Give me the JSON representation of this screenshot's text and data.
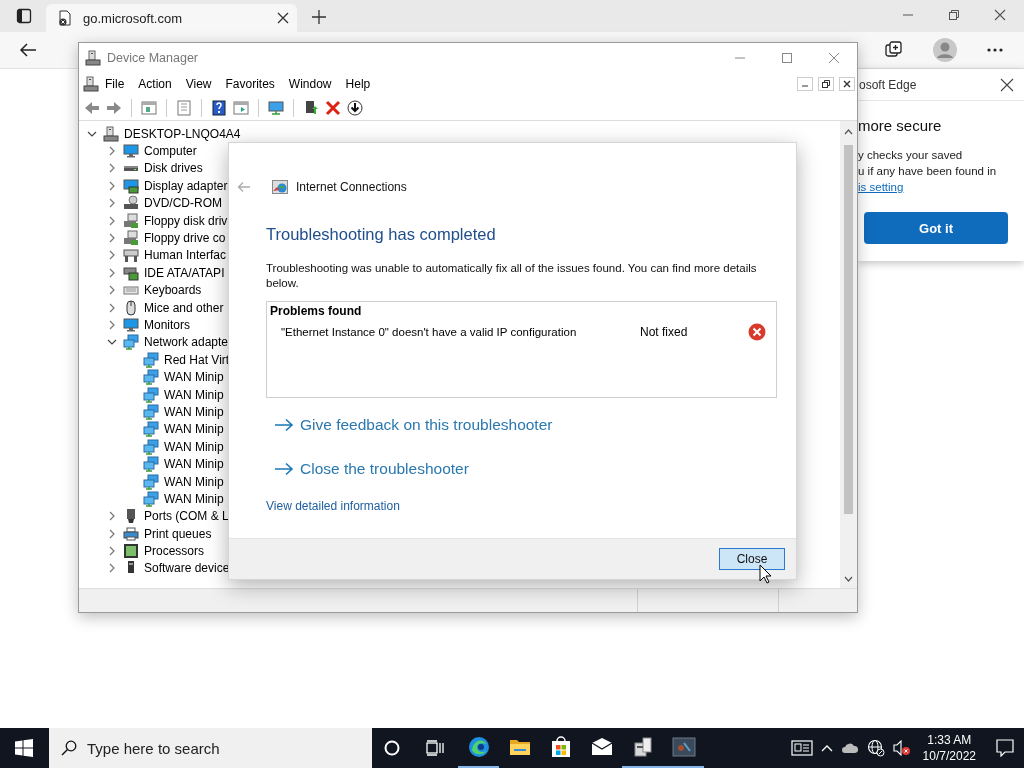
{
  "browser": {
    "tab": {
      "title": "go.microsoft.com",
      "selected": true
    },
    "popup": {
      "title": "osoft Edge",
      "heading": "more secure",
      "lines": [
        "y checks your saved",
        "u if any have been found in"
      ],
      "link": "is setting",
      "button": "Got it"
    }
  },
  "device_manager": {
    "title": "Device Manager",
    "menu": [
      "File",
      "Action",
      "View",
      "Favorites",
      "Window",
      "Help"
    ],
    "tree": {
      "label": "DESKTOP-LNQO4A4",
      "kind": "pc",
      "expanded": true,
      "children": [
        {
          "label": "Computer",
          "kind": "monitor",
          "expanded": false
        },
        {
          "label": "Disk drives",
          "kind": "drive",
          "expanded": false
        },
        {
          "label": "Display adapter",
          "kind": "display",
          "expanded": false
        },
        {
          "label": "DVD/CD-ROM",
          "kind": "disc",
          "expanded": false
        },
        {
          "label": "Floppy disk driv",
          "kind": "floppy",
          "expanded": false
        },
        {
          "label": "Floppy drive co",
          "kind": "floppy",
          "expanded": false
        },
        {
          "label": "Human Interfac",
          "kind": "hid",
          "expanded": false
        },
        {
          "label": "IDE ATA/ATAPI",
          "kind": "chip",
          "expanded": false
        },
        {
          "label": "Keyboards",
          "kind": "keyboard",
          "expanded": false
        },
        {
          "label": "Mice and other",
          "kind": "mouse",
          "expanded": false
        },
        {
          "label": "Monitors",
          "kind": "monitor",
          "expanded": false
        },
        {
          "label": "Network adapte",
          "kind": "network",
          "expanded": true,
          "children": [
            {
              "label": "Red Hat Virt",
              "kind": "network"
            },
            {
              "label": "WAN Minip",
              "kind": "network"
            },
            {
              "label": "WAN Minip",
              "kind": "network"
            },
            {
              "label": "WAN Minip",
              "kind": "network"
            },
            {
              "label": "WAN Minip",
              "kind": "network"
            },
            {
              "label": "WAN Minip",
              "kind": "network"
            },
            {
              "label": "WAN Minip",
              "kind": "network"
            },
            {
              "label": "WAN Minip",
              "kind": "network"
            },
            {
              "label": "WAN Minip",
              "kind": "network"
            }
          ]
        },
        {
          "label": "Ports (COM & L",
          "kind": "port",
          "expanded": false
        },
        {
          "label": "Print queues",
          "kind": "printer",
          "expanded": false
        },
        {
          "label": "Processors",
          "kind": "cpu",
          "expanded": false
        },
        {
          "label": "Software device",
          "kind": "software",
          "expanded": false
        }
      ]
    }
  },
  "dialog": {
    "title": "Internet Connections",
    "heading": "Troubleshooting has completed",
    "message": "Troubleshooting was unable to automatically fix all of the issues found. You can find more details below.",
    "problems": {
      "header": "Problems found",
      "rows": [
        {
          "issue": "\"Ethernet Instance 0\" doesn't have a valid IP configuration",
          "status": "Not fixed",
          "fixed": false
        }
      ]
    },
    "links": [
      "Give feedback on this troubleshooter",
      "Close the troubleshooter"
    ],
    "detail_link": "View detailed information",
    "button": "Close"
  },
  "taskbar": {
    "search": {
      "placeholder": "Type here to search"
    },
    "apps": [
      {
        "kind": "edge",
        "running": true
      },
      {
        "kind": "folder",
        "running": false
      },
      {
        "kind": "store",
        "running": false
      },
      {
        "kind": "mail",
        "running": false
      },
      {
        "kind": "devmgr",
        "running": true
      },
      {
        "kind": "troubleshooter",
        "running": true
      }
    ],
    "time": "1:33 AM",
    "date": "10/7/2022"
  }
}
